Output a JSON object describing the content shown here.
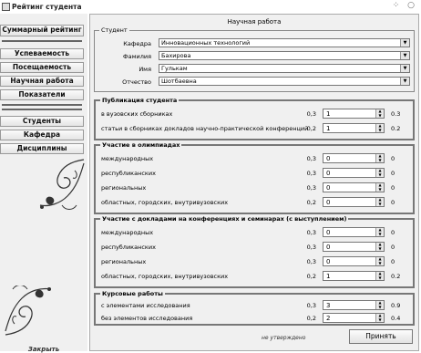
{
  "window": {
    "title": "Рейтинг студента",
    "controls": "⁘ ○"
  },
  "sidebar": {
    "top_items": [
      {
        "label": "Суммарный рейтинг"
      },
      {
        "label": "Успеваемость"
      },
      {
        "label": "Посещаемость"
      },
      {
        "label": "Научная работа"
      },
      {
        "label": "Показатели"
      }
    ],
    "bottom_items": [
      {
        "label": "Студенты"
      },
      {
        "label": "Кафедра"
      },
      {
        "label": "Дисциплины"
      }
    ],
    "footer": "Закрыть"
  },
  "main": {
    "title": "Научная работа",
    "student": {
      "legend": "Студент",
      "fields": [
        {
          "label": "Кафедра",
          "value": "Инновационных технологий"
        },
        {
          "label": "Фамилия",
          "value": "Бахирова"
        },
        {
          "label": "Имя",
          "value": "Гулькам"
        },
        {
          "label": "Отчество",
          "value": "Шотбаевна"
        }
      ]
    },
    "groups": [
      {
        "legend": "Публикация студента",
        "rows": [
          {
            "label": "в вузовских сборниках",
            "weight": "0,3",
            "value": "1",
            "result": "0.3"
          },
          {
            "label": "статьи в сборниках докладов научно-практической конференций",
            "weight": "0,2",
            "value": "1",
            "result": "0.2"
          }
        ]
      },
      {
        "legend": "Участие в олимпиадах",
        "rows": [
          {
            "label": "международных",
            "weight": "0,3",
            "value": "0",
            "result": "0"
          },
          {
            "label": "республиканских",
            "weight": "0,3",
            "value": "0",
            "result": "0"
          },
          {
            "label": "региональных",
            "weight": "0,3",
            "value": "0",
            "result": "0"
          },
          {
            "label": "областных, городских, внутривузовских",
            "weight": "0,2",
            "value": "0",
            "result": "0"
          }
        ]
      },
      {
        "legend": "Участие с докладами на конференциях и семинарах (с выступлением)",
        "rows": [
          {
            "label": "международных",
            "weight": "0,3",
            "value": "0",
            "result": "0"
          },
          {
            "label": "республиканских",
            "weight": "0,3",
            "value": "0",
            "result": "0"
          },
          {
            "label": "региональных",
            "weight": "0,3",
            "value": "0",
            "result": "0"
          },
          {
            "label": "областных, городских, внутривузовских",
            "weight": "0,2",
            "value": "1",
            "result": "0.2"
          }
        ]
      },
      {
        "legend": "Курсовые работы",
        "rows": [
          {
            "label": "с элементами исследования",
            "weight": "0,3",
            "value": "3",
            "result": "0.9"
          },
          {
            "label": "без элементов исследования",
            "weight": "0,2",
            "value": "2",
            "result": "0.4"
          }
        ]
      }
    ],
    "status": "не утверждено",
    "submit_label": "Принять"
  }
}
